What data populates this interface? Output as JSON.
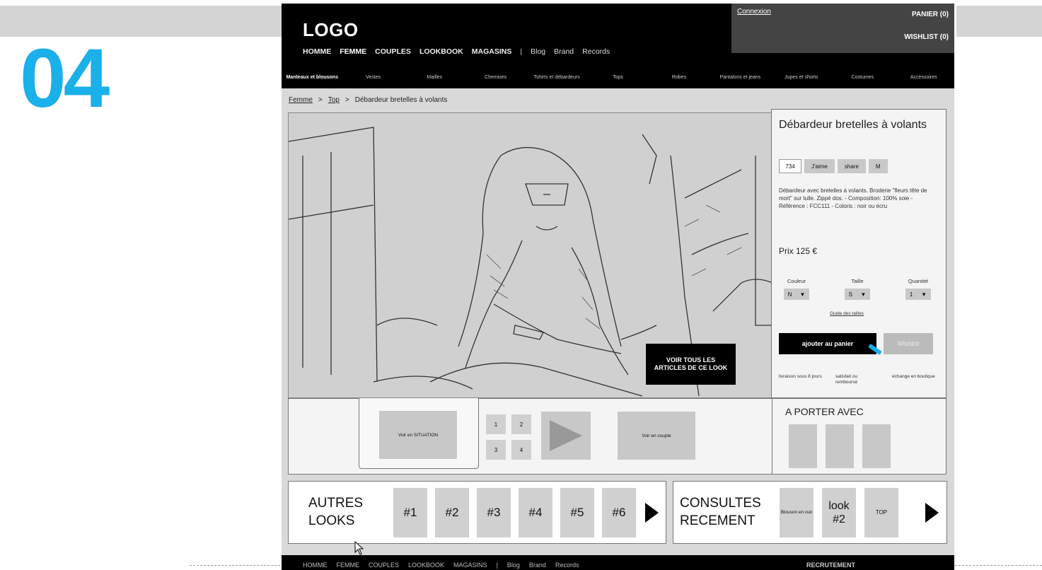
{
  "slide_number": "04",
  "header": {
    "logo": "LOGO",
    "main_nav": [
      "HOMME",
      "FEMME",
      "COUPLES",
      "LOOKBOOK",
      "MAGASINS"
    ],
    "main_nav_active": "FEMME",
    "separator": "|",
    "secondary_nav": [
      "Blog",
      "Brand",
      "Records"
    ],
    "connexion": "Connexion",
    "panier": "PANIER (0)",
    "wishlist": "WISHLIST (0)",
    "sub_nav": [
      "Manteaux et blousons",
      "Vestes",
      "Mailles",
      "Chemises",
      "Tshirts et débardeurs",
      "Tops",
      "Robes",
      "Pantalons et jeans",
      "Jupes et shorts",
      "Costumes",
      "Accessoires"
    ]
  },
  "breadcrumb": [
    "Femme",
    ">",
    "Top",
    ">",
    "Débardeur bretelles à volants"
  ],
  "hero": {
    "look_button": "VOIR TOUS LES ARTICLES DE CE LOOK"
  },
  "product": {
    "title": "Débardeur bretelles à volants",
    "like_count": "734",
    "like_label": "J'aime",
    "share_label": "share",
    "mail_label": "M",
    "description": "Débardeur avec bretelles à volants. Broderie \"fleurs tête de mort\" sur tulle. Zippé dos. - Composition: 100% soie - Référence : FCC111 - Coloris : noir ou écru",
    "price": "Prix  125 €",
    "couleur_label": "Couleur",
    "couleur_value": "N",
    "taille_label": "Taille",
    "taille_value": "S",
    "quantite_label": "Quantité",
    "quantite_value": "1",
    "guide_tailles": "Guide des tailles",
    "add_to_cart": "ajouter au panier",
    "wishlist_button": "Wishlist",
    "benefits": [
      "livraison sous 8 jours",
      "satisfait ou remboursé",
      "échange en boutique"
    ]
  },
  "carousel": {
    "situation_label": "Voir en SITUATION",
    "thumbs": [
      "1",
      "2",
      "3",
      "4"
    ],
    "couple_label": "Voir en couple",
    "porter_title": "A PORTER AVEC"
  },
  "autres_looks": {
    "title_line1": "AUTRES",
    "title_line2": "LOOKS",
    "items": [
      "#1",
      "#2",
      "#3",
      "#4",
      "#5",
      "#6"
    ]
  },
  "consultes": {
    "title_line1": "CONSULTES",
    "title_line2": "RECEMENT",
    "item1": "Blouson en cuir",
    "item2": "look #2",
    "item3": "TOP"
  },
  "footer": {
    "nav": [
      "HOMME",
      "FEMME",
      "COUPLES",
      "LOOKBOOK",
      "MAGASINS",
      "|",
      "Blog",
      "Brand",
      "Records"
    ],
    "recrutement": "RECRUTEMENT"
  }
}
